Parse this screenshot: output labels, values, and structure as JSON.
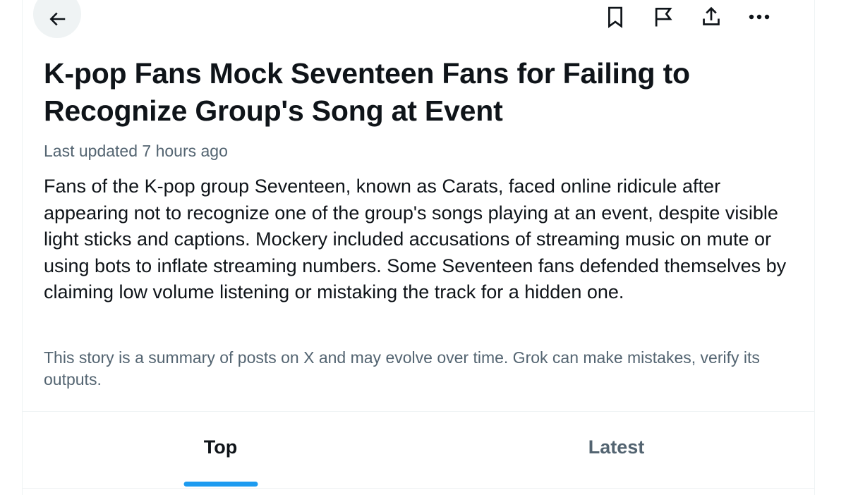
{
  "header": {
    "back_icon": "arrow-left-icon",
    "actions": [
      {
        "icon": "bookmark-icon"
      },
      {
        "icon": "flag-icon"
      },
      {
        "icon": "share-icon"
      },
      {
        "icon": "more-icon"
      }
    ]
  },
  "story": {
    "title": "K-pop Fans Mock Seventeen Fans for Failing to Recognize Group's Song at Event",
    "updated": "Last updated 7 hours ago",
    "summary": "Fans of the K-pop group Seventeen, known as Carats, faced online ridicule after appearing not to recognize one of the group's songs playing at an event, despite visible light sticks and captions. Mockery included accusations of streaming music on mute or using bots to inflate streaming numbers. Some Seventeen fans defended themselves by claiming low volume listening or mistaking the track for a hidden one.",
    "disclaimer": "This story is a summary of posts on X and may evolve over time. Grok can make mistakes, verify its outputs."
  },
  "tabs": [
    {
      "label": "Top",
      "active": true
    },
    {
      "label": "Latest",
      "active": false
    }
  ],
  "colors": {
    "accent": "#1d9bf0",
    "text_primary": "#0f1419",
    "text_secondary": "#536471",
    "border": "#eff3f4"
  }
}
